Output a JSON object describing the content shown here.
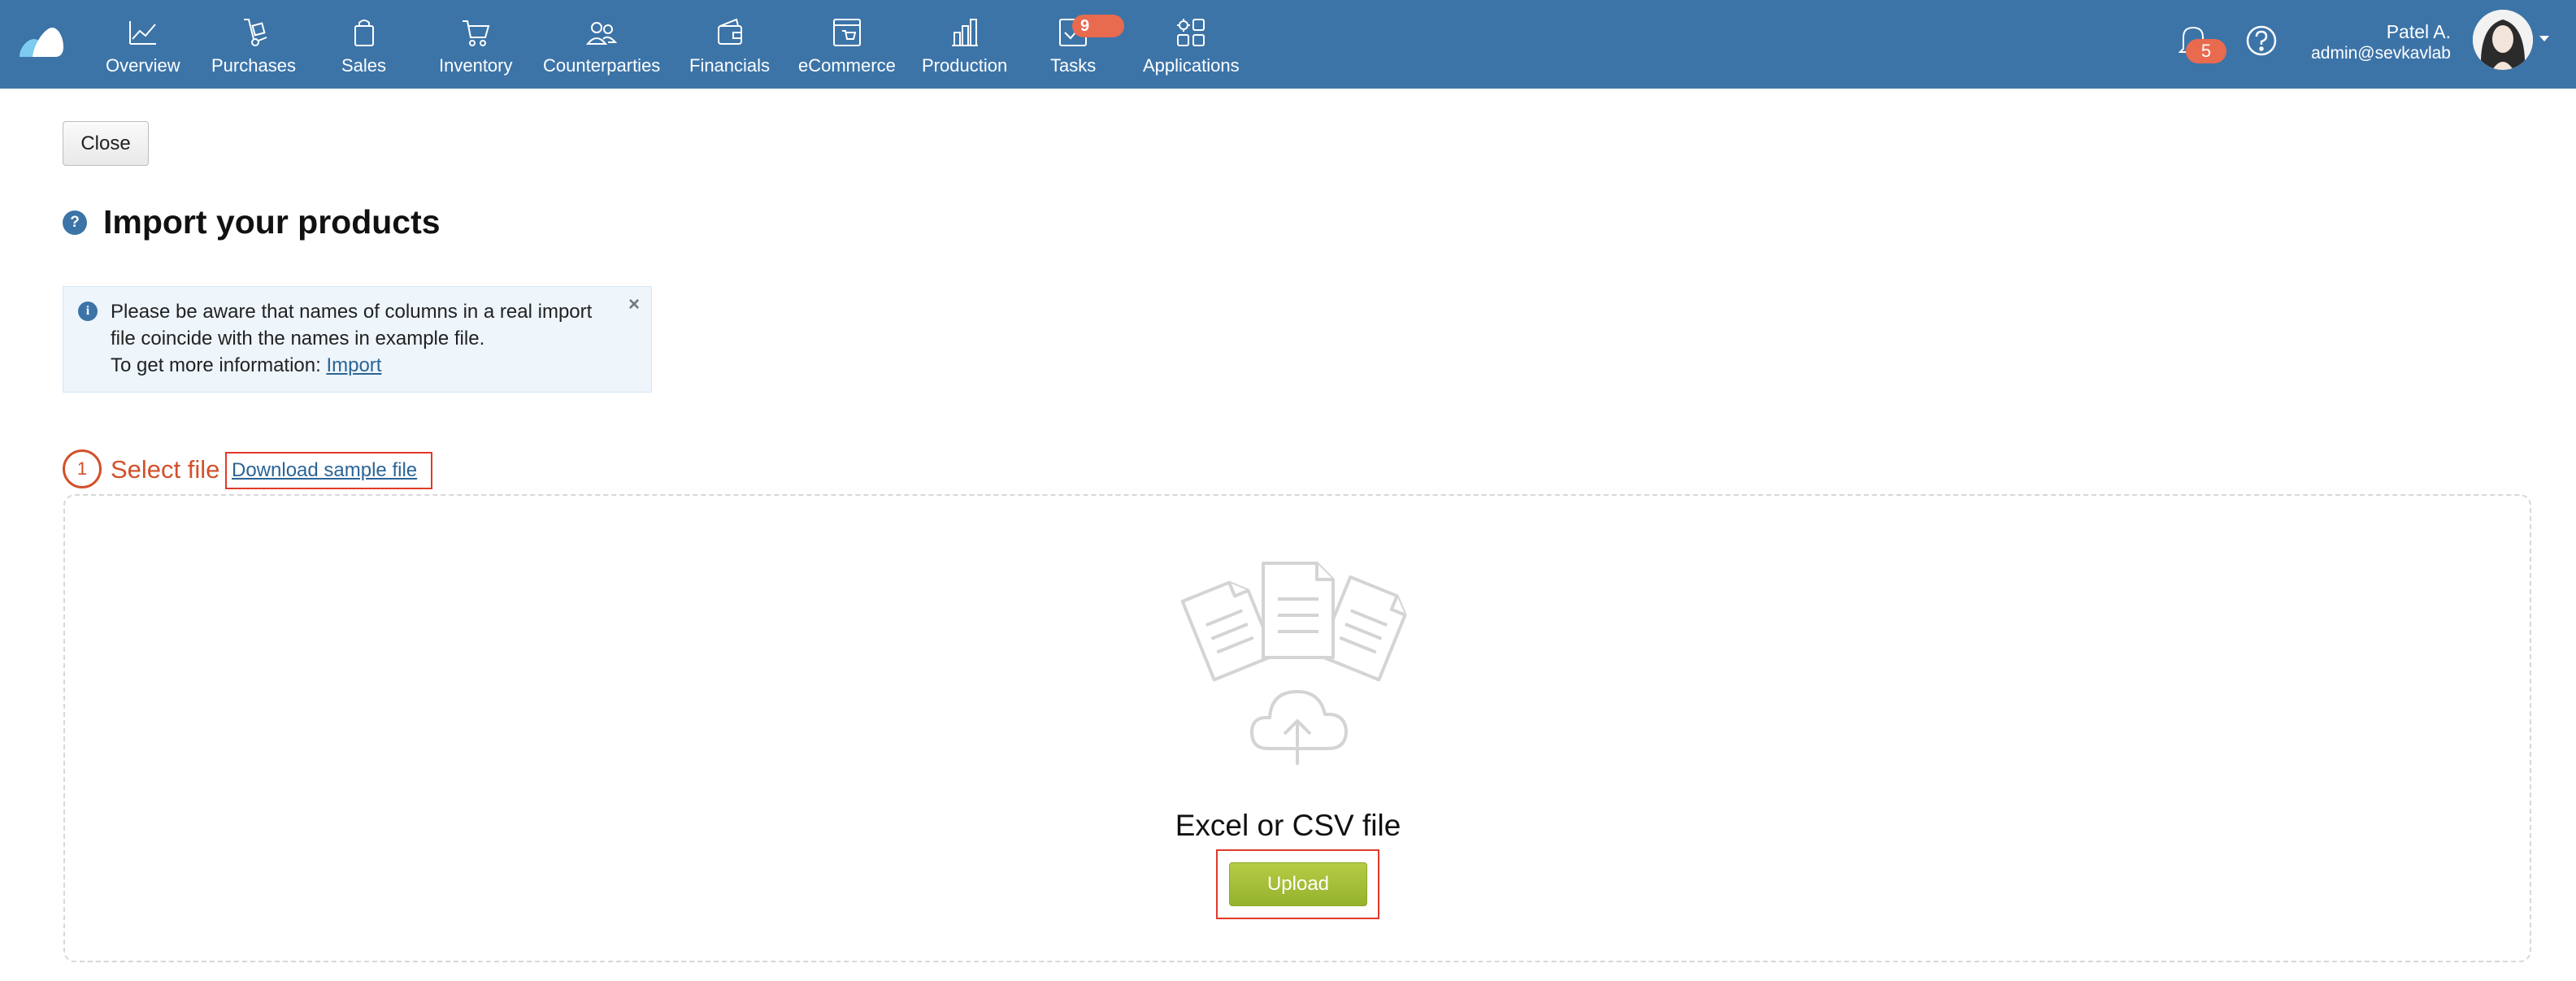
{
  "nav": {
    "items": [
      {
        "label": "Overview",
        "icon": "chart-line-icon"
      },
      {
        "label": "Purchases",
        "icon": "dolly-icon"
      },
      {
        "label": "Sales",
        "icon": "shopping-bag-icon"
      },
      {
        "label": "Inventory",
        "icon": "cart-icon"
      },
      {
        "label": "Counterparties",
        "icon": "people-icon"
      },
      {
        "label": "Financials",
        "icon": "wallet-icon"
      },
      {
        "label": "eCommerce",
        "icon": "storefront-icon"
      },
      {
        "label": "Production",
        "icon": "factory-icon"
      },
      {
        "label": "Tasks",
        "icon": "task-check-icon"
      },
      {
        "label": "Applications",
        "icon": "apps-grid-icon"
      }
    ],
    "tasks_badge": "9",
    "notifications_badge": "5",
    "user_name": "Patel A.",
    "user_email": "admin@sevkavlab"
  },
  "page": {
    "close_label": "Close",
    "help_glyph": "?",
    "title": "Import your products"
  },
  "notice": {
    "line1": "Please be aware that names of columns in a real import file coincide with the names in example file.",
    "line2_prefix": "To get more information: ",
    "link_label": "Import",
    "close_glyph": "×",
    "info_glyph": "i"
  },
  "step": {
    "number": "1",
    "label": "Select file",
    "sample_link": "Download sample file"
  },
  "dropzone": {
    "caption": "Excel or CSV file",
    "upload_label": "Upload"
  },
  "colors": {
    "topbar": "#3c74a8",
    "accent_orange": "#d2512b",
    "badge": "#e86a4f",
    "upload_green": "#a4bf38",
    "highlight_red": "#e03a2a"
  }
}
